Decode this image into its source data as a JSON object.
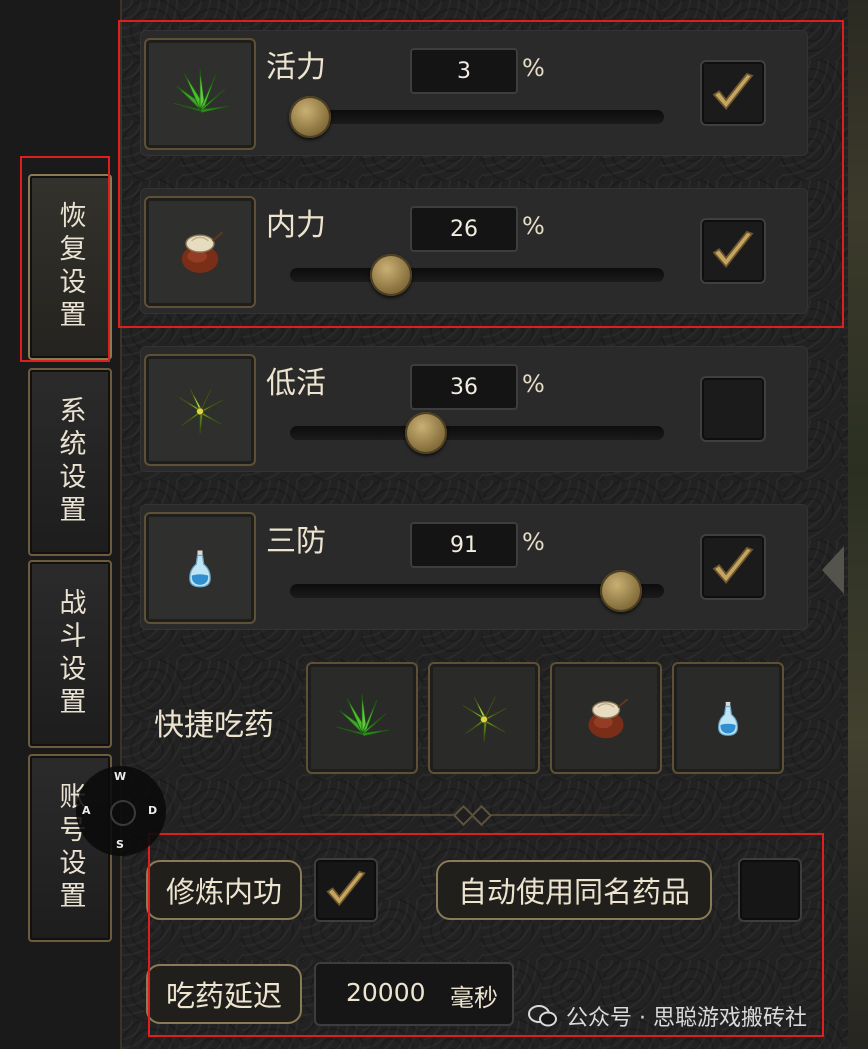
{
  "side_tabs": [
    "恢复设置",
    "系统设置",
    "战斗设置",
    "账号设置"
  ],
  "recovery_rows": [
    {
      "label": "活力",
      "value": "3",
      "unit": "%",
      "slider_percent": 3,
      "checked": true,
      "icon": "green-herb-icon"
    },
    {
      "label": "内力",
      "value": "26",
      "unit": "%",
      "slider_percent": 26,
      "checked": true,
      "icon": "clay-pot-icon"
    },
    {
      "label": "低活",
      "value": "36",
      "unit": "%",
      "slider_percent": 36,
      "checked": false,
      "icon": "yellow-green-herb-icon"
    },
    {
      "label": "三防",
      "value": "91",
      "unit": "%",
      "slider_percent": 91,
      "checked": true,
      "icon": "blue-potion-bottle-icon"
    }
  ],
  "quick_potions": {
    "label": "快捷吃药",
    "icons": [
      "green-herb-icon",
      "yellow-green-herb-icon",
      "clay-pot-icon",
      "blue-potion-bottle-icon"
    ]
  },
  "options": {
    "cultivate_label": "修炼内功",
    "cultivate_checked": true,
    "auto_same_name_label": "自动使用同名药品",
    "auto_same_name_checked": false,
    "delay_label": "吃药延迟",
    "delay_value": "20000",
    "delay_unit": "毫秒"
  },
  "compass": {
    "north": "W",
    "west": "A",
    "east": "D",
    "south": "S"
  },
  "watermark": "公众号 · 思聪游戏搬砖社",
  "colors": {
    "highlight": "#e01e1e",
    "gold_border": "#8a7a56",
    "check_gold": "#b89a52"
  }
}
